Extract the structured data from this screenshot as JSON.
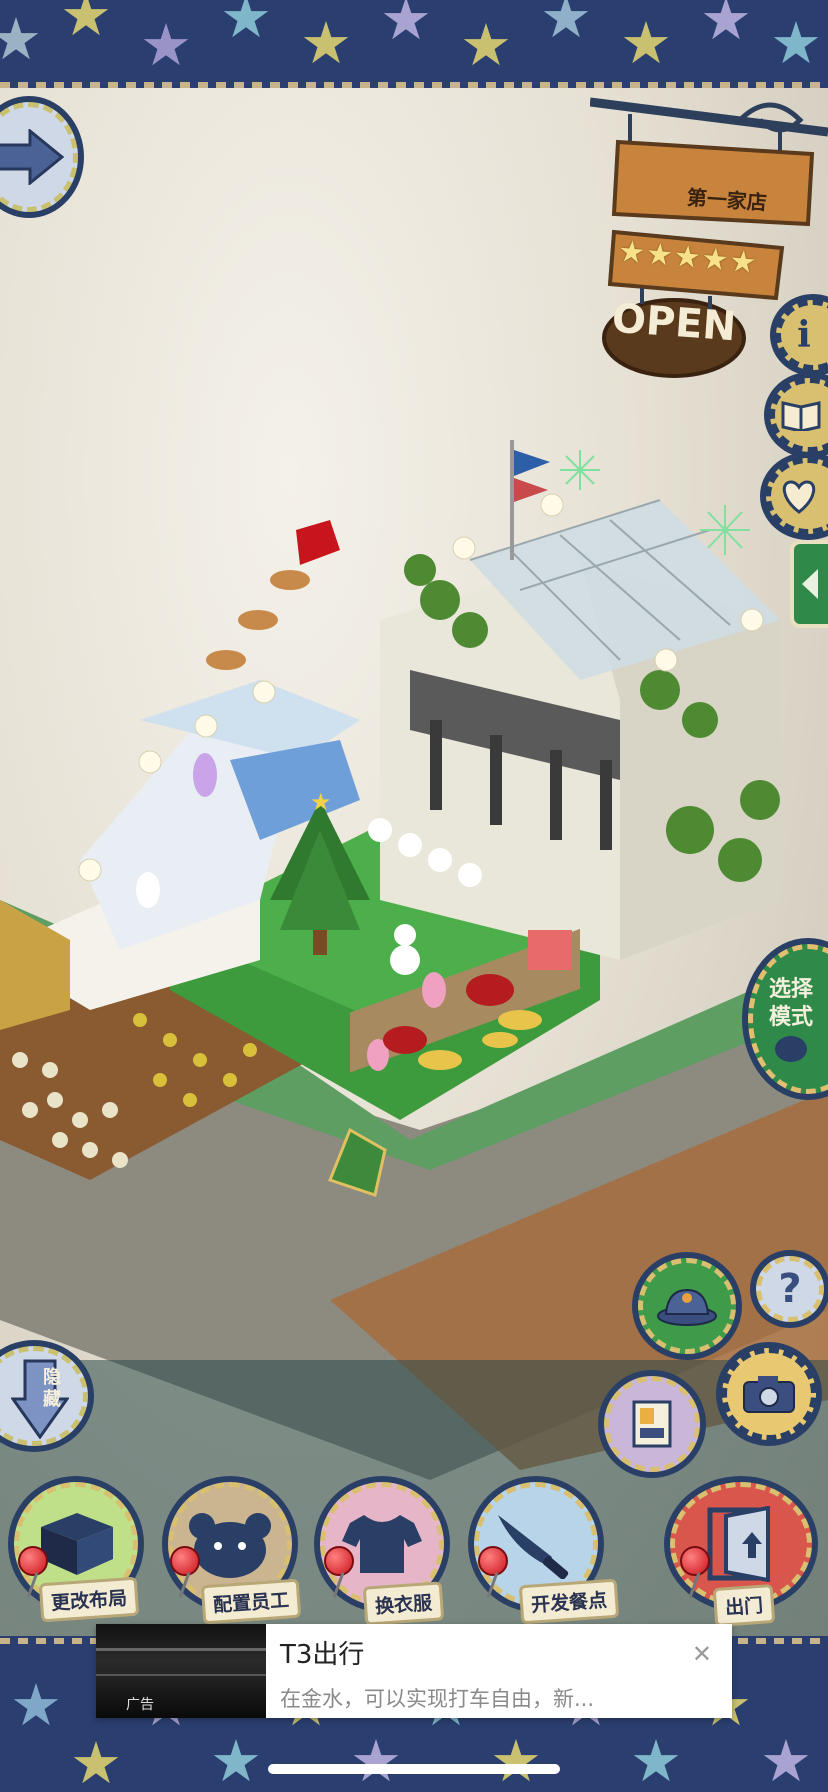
{
  "shop_sign": {
    "name": "第一家店",
    "stars": 5,
    "status": "OPEN"
  },
  "side_buttons": {
    "info_glyph": "i",
    "select_mode_label": "选择\n模式",
    "hide_label": "隐\n藏",
    "help_glyph": "?"
  },
  "menu": {
    "layout_label": "更改布局",
    "staff_label": "配置员工",
    "outfit_label": "换衣服",
    "menu_label": "开发餐点",
    "exit_label": "出门"
  },
  "ad": {
    "title": "T3出行",
    "subtitle": "在金水，可以实现打车自由，新...",
    "tag": "广告",
    "close_glyph": "✕"
  },
  "icons": [
    "arrow-right-icon",
    "info-icon",
    "book-icon",
    "heart-icon",
    "back-arrow-icon",
    "hat-icon",
    "help-icon",
    "picture-icon",
    "camera-icon",
    "down-arrow-icon",
    "table-icon",
    "bear-icon",
    "shirt-icon",
    "knife-icon",
    "door-icon",
    "close-icon"
  ],
  "colors": {
    "navy": "#2a3f70",
    "wood": "#c8843c",
    "green_button": "#2f8a4a",
    "grass": "#3d9a3d"
  }
}
